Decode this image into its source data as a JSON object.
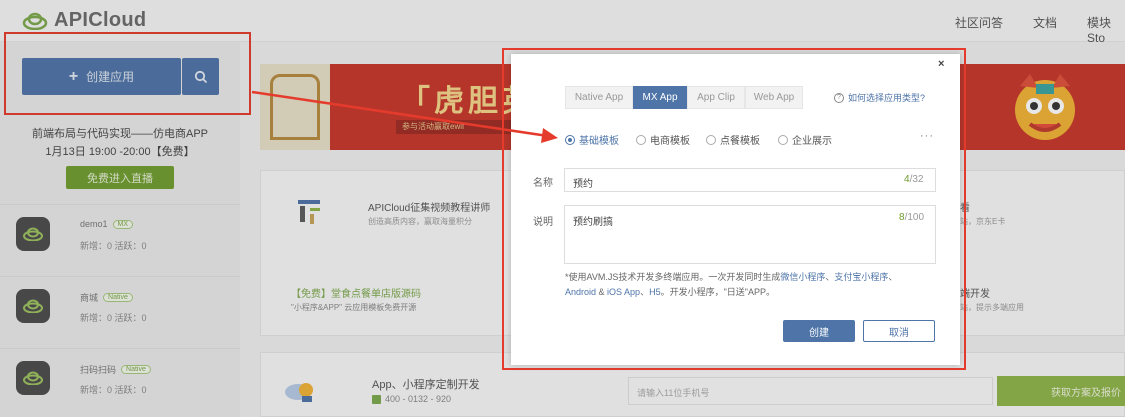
{
  "header": {
    "logo_text": "APICloud",
    "nav": [
      "社区问答",
      "文档",
      "模块Sto"
    ]
  },
  "sidebar": {
    "create_label": "创建应用",
    "promo_title": "前端布局与代码实现——仿电商APP",
    "promo_time": "1月13日 19:00 -20:00【免费】",
    "live_button": "免费进入直播",
    "apps": [
      {
        "name": "demo1",
        "tag": "MX",
        "stats": "新增：0  活跃：0"
      },
      {
        "name": "商城",
        "tag": "Native",
        "stats": "新增：0  活跃：0"
      },
      {
        "name": "扫码扫码",
        "tag": "Native",
        "stats": "新增：0  活跃：0"
      }
    ]
  },
  "banner": {
    "title": "「虎胆英",
    "subtitle": "参与活动赢取ewif"
  },
  "cards": {
    "a_title": "APICloud征集视频教程讲师",
    "a_sub": "创造高质内容，赢取海量积分",
    "b_title": "【免费】堂食点餐单店版源码",
    "b_sub": "\"小程序&APP\" 云应用模板免费开源",
    "c_title": "看",
    "c_sub": "站，京东E卡",
    "d_title": "端开发",
    "d_sub": "站，提示多端应用"
  },
  "bottom": {
    "title": "App、小程序定制开发",
    "phone": "400 - 0132 - 920",
    "input_placeholder": "请输入11位手机号",
    "button": "获取方案及报价"
  },
  "modal": {
    "close": "×",
    "tabs": [
      {
        "label": "Native App",
        "active": false
      },
      {
        "label": "MX App",
        "active": true
      },
      {
        "label": "App Clip",
        "active": false
      },
      {
        "label": "Web App",
        "active": false
      }
    ],
    "help_link": "如何选择应用类型?",
    "templates": [
      {
        "label": "基础模板",
        "selected": true
      },
      {
        "label": "电商模板",
        "selected": false
      },
      {
        "label": "点餐模板",
        "selected": false
      },
      {
        "label": "企业展示",
        "selected": false
      }
    ],
    "more": "···",
    "name_label": "名称",
    "name_value": "预约",
    "name_count": "4",
    "name_max": "/32",
    "desc_label": "说明",
    "desc_value": "预约刷搞",
    "desc_count": "8",
    "desc_max": "/100",
    "note_prefix": "*使用AVM.JS技术开发多终端应用。一次开发同时生成",
    "note_link1": "微信小程序",
    "note_sep": "、",
    "note_link2": "支付宝小程序",
    "note_link3": "Android",
    "note_amp": " & ",
    "note_link4": "iOS App",
    "note_comma": "、",
    "note_link5": "H5",
    "note_suffix": "。开发小程序，\"日送\"APP。",
    "ok_button": "创建",
    "cancel_button": "取消"
  },
  "colors": {
    "accent": "#4e74a8",
    "green": "#6f9c2e",
    "highlight": "#e53b2c"
  }
}
